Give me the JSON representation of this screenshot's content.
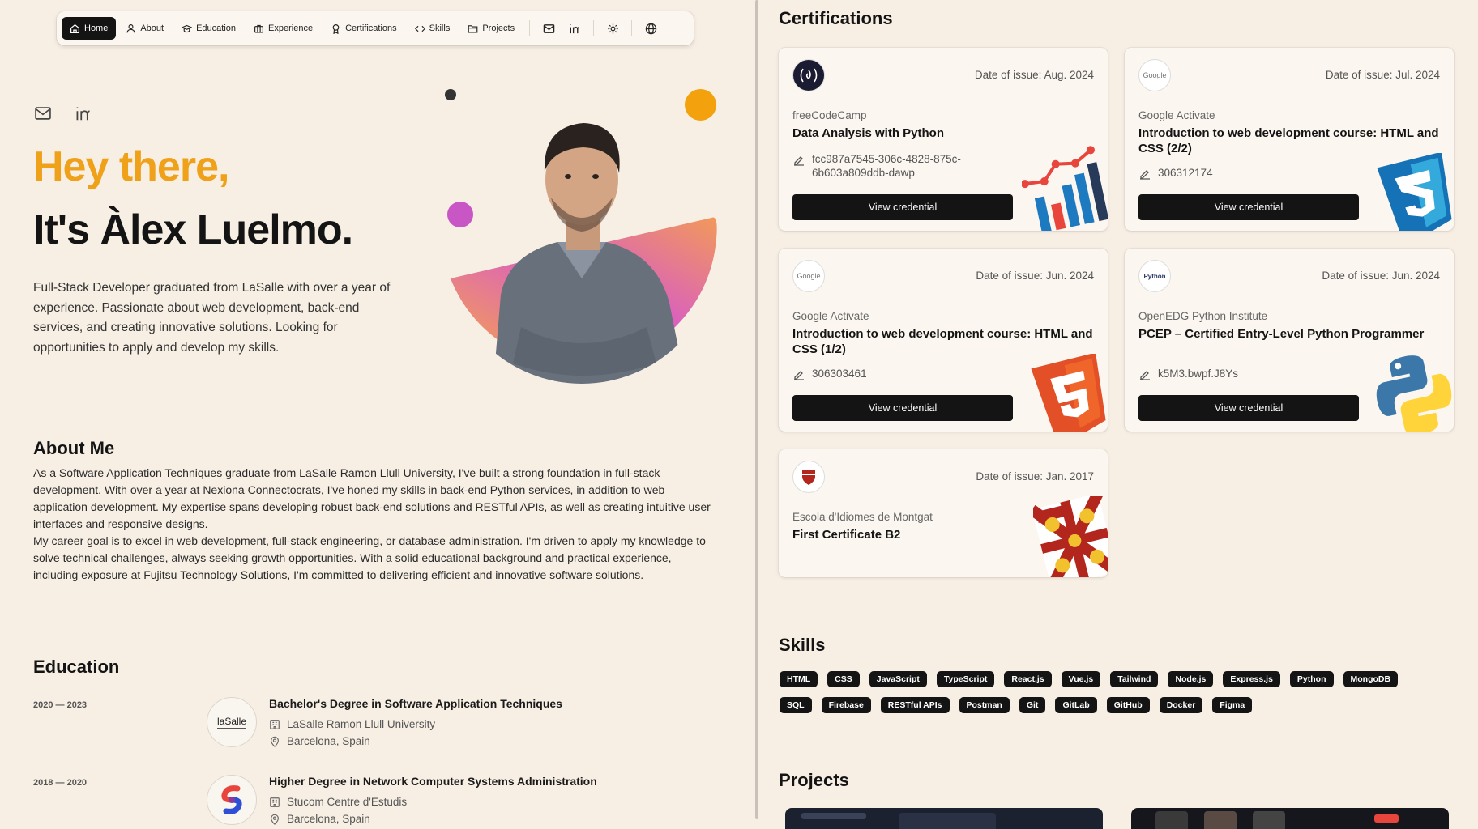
{
  "nav": {
    "items": [
      {
        "label": "Home",
        "icon": "home-icon",
        "active": true
      },
      {
        "label": "About",
        "icon": "user-icon",
        "active": false
      },
      {
        "label": "Education",
        "icon": "graduation-cap-icon",
        "active": false
      },
      {
        "label": "Experience",
        "icon": "briefcase-icon",
        "active": false
      },
      {
        "label": "Certifications",
        "icon": "award-icon",
        "active": false
      },
      {
        "label": "Skills",
        "icon": "code-icon",
        "active": false
      },
      {
        "label": "Projects",
        "icon": "folder-icon",
        "active": false
      }
    ],
    "icons": [
      "mail-icon",
      "linkedin-icon",
      "sun-icon",
      "globe-icon"
    ]
  },
  "hero": {
    "greeting": "Hey there,",
    "name": "It's Àlex Luelmo.",
    "description": "Full-Stack Developer graduated from LaSalle with over a year of experience. Passionate about web development, back-end services, and creating innovative solutions. Looking for opportunities to apply and develop my skills.",
    "accent": "#f0a11a"
  },
  "about": {
    "title": "About Me",
    "paragraph1": "As a Software Application Techniques graduate from LaSalle Ramon Llull University, I've built a strong foundation in full-stack development. With over a year at Nexiona Connectocrats, I've honed my skills in back-end Python services, in addition to web application development. My expertise spans developing robust back-end solutions and RESTful APIs, as well as creating intuitive user interfaces and responsive designs.",
    "paragraph2": "My career goal is to excel in web development, full-stack engineering, or database administration. I'm driven to apply my knowledge to solve technical challenges, always seeking growth opportunities. With a solid educational background and practical experience, including exposure at Fujitsu Technology Solutions, I'm committed to delivering efficient and innovative software solutions."
  },
  "education": {
    "title": "Education",
    "items": [
      {
        "dates": "2020 — 2023",
        "logo_text": "laSalle",
        "degree": "Bachelor's Degree in Software Application Techniques",
        "school": "LaSalle Ramon Llull University",
        "location": "Barcelona, Spain"
      },
      {
        "dates": "2018 — 2020",
        "logo_text": "",
        "degree": "Higher Degree in Network Computer Systems Administration",
        "school": "Stucom Centre d'Estudis",
        "location": "Barcelona, Spain"
      }
    ]
  },
  "certifications": {
    "title": "Certifications",
    "button_label": "View credential",
    "items": [
      {
        "date": "Date of issue: Aug. 2024",
        "issuer": "freeCodeCamp",
        "name": "Data Analysis with Python",
        "credential_id": "fcc987a7545-306c-4828-875c-6b603a809ddb-dawp",
        "art": "chart-icon"
      },
      {
        "date": "Date of issue: Jul. 2024",
        "issuer": "Google Activate",
        "name": "Introduction to web development course: HTML and CSS (2/2)",
        "credential_id": "306312174",
        "art": "css3-icon"
      },
      {
        "date": "Date of issue: Jun. 2024",
        "issuer": "Google Activate",
        "name": "Introduction to web development course: HTML and CSS (1/2)",
        "credential_id": "306303461",
        "art": "html5-icon"
      },
      {
        "date": "Date of issue: Jun. 2024",
        "issuer": "OpenEDG Python Institute",
        "name": "PCEP – Certified Entry-Level Python Programmer",
        "credential_id": "k5M3.bwpf.J8Ys",
        "art": "python-icon"
      },
      {
        "date": "Date of issue: Jan. 2017",
        "issuer": "Escola d'Idiomes de Montgat",
        "name": "First Certificate B2",
        "credential_id": "",
        "art": "cambridge-crest-icon"
      }
    ]
  },
  "skills": {
    "title": "Skills",
    "row1": [
      "HTML",
      "CSS",
      "JavaScript",
      "TypeScript",
      "React.js",
      "Vue.js",
      "Tailwind",
      "Node.js",
      "Express.js",
      "Python",
      "MongoDB"
    ],
    "row2": [
      "SQL",
      "Firebase",
      "RESTful APIs",
      "Postman",
      "Git",
      "GitLab",
      "GitHub",
      "Docker",
      "Figma"
    ]
  },
  "projects": {
    "title": "Projects"
  }
}
